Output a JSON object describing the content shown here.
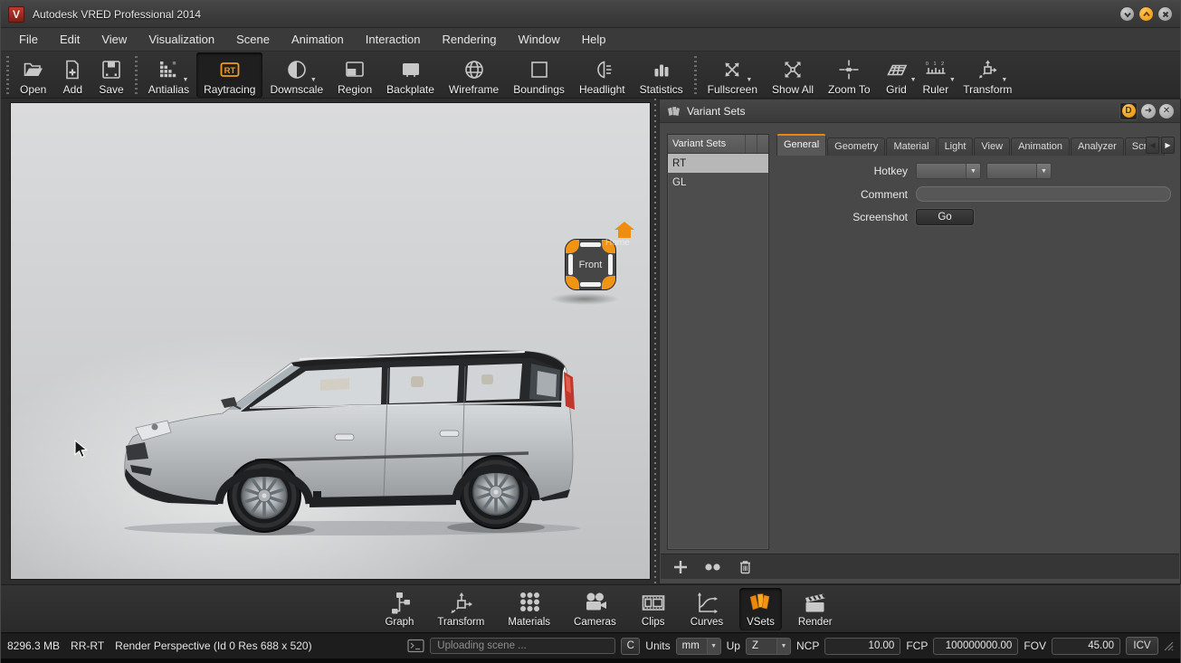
{
  "window": {
    "title": "Autodesk VRED Professional 2014"
  },
  "menu": {
    "items": [
      "File",
      "Edit",
      "View",
      "Visualization",
      "Scene",
      "Animation",
      "Interaction",
      "Rendering",
      "Window",
      "Help"
    ]
  },
  "toolbar": {
    "active_item": "Raytracing",
    "items": [
      {
        "label": "Open",
        "icon": "open-folder-icon"
      },
      {
        "label": "Add",
        "icon": "add-file-icon"
      },
      {
        "label": "Save",
        "icon": "save-icon"
      },
      {
        "label": "Antialias",
        "icon": "antialias-icon",
        "dropdown": true
      },
      {
        "label": "Raytracing",
        "icon": "raytracing-icon",
        "icon_text": "RT",
        "active": true
      },
      {
        "label": "Downscale",
        "icon": "downscale-icon",
        "dropdown": true
      },
      {
        "label": "Region",
        "icon": "region-icon"
      },
      {
        "label": "Backplate",
        "icon": "backplate-icon"
      },
      {
        "label": "Wireframe",
        "icon": "wireframe-icon"
      },
      {
        "label": "Boundings",
        "icon": "boundings-icon"
      },
      {
        "label": "Headlight",
        "icon": "headlight-icon"
      },
      {
        "label": "Statistics",
        "icon": "statistics-icon"
      },
      {
        "label": "Fullscreen",
        "icon": "fullscreen-icon",
        "dropdown": true
      },
      {
        "label": "Show All",
        "icon": "show-all-icon"
      },
      {
        "label": "Zoom To",
        "icon": "zoom-to-icon"
      },
      {
        "label": "Grid",
        "icon": "grid-icon",
        "dropdown": true
      },
      {
        "label": "Ruler",
        "icon": "ruler-icon",
        "icon_text": "0 1 2",
        "dropdown": true
      },
      {
        "label": "Transform",
        "icon": "transform-icon",
        "dropdown": true
      }
    ]
  },
  "viewport": {
    "viewcube_label": "Front",
    "home_label": "Home",
    "model": "silver SUV, side view"
  },
  "panel": {
    "title": "Variant Sets",
    "dock_buttons": {
      "d": "D"
    },
    "list": {
      "header": "Variant Sets",
      "items": [
        "RT",
        "GL"
      ],
      "selected": "RT"
    },
    "tabs": [
      "General",
      "Geometry",
      "Material",
      "Light",
      "View",
      "Animation",
      "Analyzer",
      "Script"
    ],
    "active_tab": "General",
    "form": {
      "hotkey_label": "Hotkey",
      "hotkey_value_1": "",
      "hotkey_value_2": "",
      "comment_label": "Comment",
      "comment_value": "",
      "screenshot_label": "Screenshot",
      "go_label": "Go"
    }
  },
  "module_bar": {
    "items": [
      "Graph",
      "Transform",
      "Materials",
      "Cameras",
      "Clips",
      "Curves",
      "VSets",
      "Render"
    ],
    "active": "VSets"
  },
  "status_bar": {
    "memory": "8296.3 MB",
    "renderer": "RR-RT",
    "view_info": "Render Perspective (Id 0 Res 688 x 520)",
    "progress_text": "Uploading scene ...",
    "console_button": "C",
    "units_label": "Units",
    "units_value": "mm",
    "up_label": "Up",
    "up_value": "Z",
    "ncp_label": "NCP",
    "ncp_value": "10.00",
    "fcp_label": "FCP",
    "fcp_value": "100000000.00",
    "fov_label": "FOV",
    "fov_value": "45.00",
    "icv_label": "ICV"
  },
  "colors": {
    "accent_orange": "#F29B1D",
    "selection_gray": "#B7B7B7",
    "viewport_light": "#D6D7D8",
    "logo_red": "#A32A22"
  }
}
